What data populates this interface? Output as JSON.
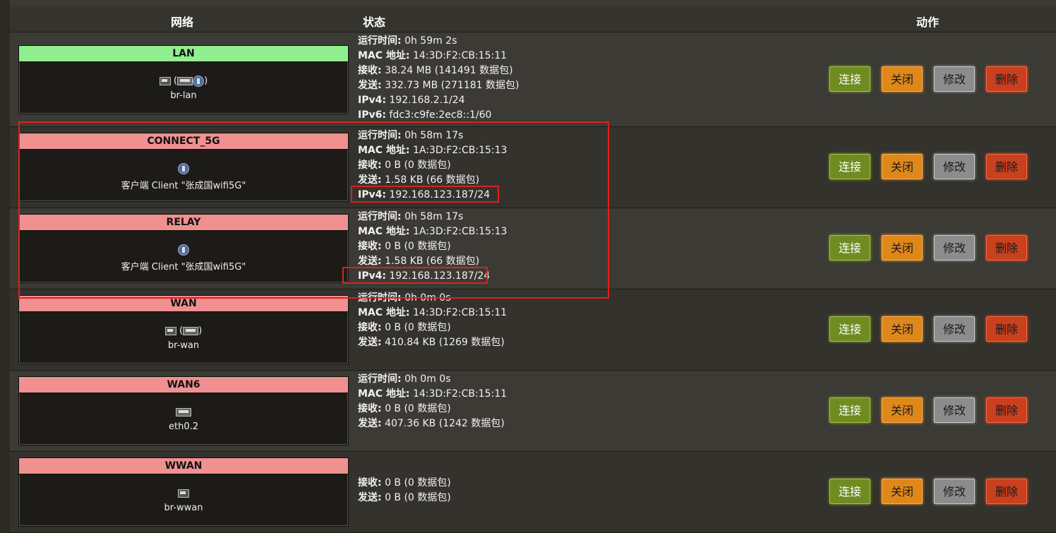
{
  "header": {
    "network": "网络",
    "status": "状态",
    "actions": "动作"
  },
  "buttons": {
    "connect": "连接",
    "stop": "关闭",
    "edit": "修改",
    "delete": "删除"
  },
  "colors": {
    "up": "#90ee90",
    "down": "#f09090",
    "highlight": "#e02020"
  },
  "interfaces": [
    {
      "name": "LAN",
      "state": "up",
      "icons": [
        "ethernet-icon",
        "switch-icon",
        "wifi-icon"
      ],
      "icon_text_open": "(",
      "icon_text_close": ")",
      "device": "br-lan",
      "status": [
        {
          "k": "运行时间:",
          "v": "0h 59m 2s"
        },
        {
          "k": "MAC 地址:",
          "v": "14:3D:F2:CB:15:11"
        },
        {
          "k": "接收:",
          "v": "38.24 MB (141491 数据包)"
        },
        {
          "k": "发送:",
          "v": "332.73 MB (271181 数据包)"
        },
        {
          "k": "IPv4:",
          "v": "192.168.2.1/24"
        },
        {
          "k": "IPv6:",
          "v": "fdc3:c9fe:2ec8::1/60"
        }
      ]
    },
    {
      "name": "CONNECT_5G",
      "state": "down",
      "icons": [
        "wifi-icon"
      ],
      "device": "客户端 Client \"张成国wifi5G\"",
      "status": [
        {
          "k": "运行时间:",
          "v": "0h 58m 17s"
        },
        {
          "k": "MAC 地址:",
          "v": "1A:3D:F2:CB:15:13"
        },
        {
          "k": "接收:",
          "v": "0 B (0 数据包)"
        },
        {
          "k": "发送:",
          "v": "1.58 KB (66 数据包)"
        },
        {
          "k": "IPv4:",
          "v": "192.168.123.187/24"
        }
      ]
    },
    {
      "name": "RELAY",
      "state": "down",
      "icons": [
        "wifi-icon"
      ],
      "device": "客户端 Client \"张成国wifi5G\"",
      "status": [
        {
          "k": "运行时间:",
          "v": "0h 58m 17s"
        },
        {
          "k": "MAC 地址:",
          "v": "1A:3D:F2:CB:15:13"
        },
        {
          "k": "接收:",
          "v": "0 B (0 数据包)"
        },
        {
          "k": "发送:",
          "v": "1.58 KB (66 数据包)"
        },
        {
          "k": "IPv4:",
          "v": "192.168.123.187/24"
        }
      ]
    },
    {
      "name": "WAN",
      "state": "down",
      "icons": [
        "ethernet-icon",
        "switch-icon"
      ],
      "icon_text_open": "(",
      "icon_text_close": ")",
      "device": "br-wan",
      "status": [
        {
          "k": "运行时间:",
          "v": "0h 0m 0s"
        },
        {
          "k": "MAC 地址:",
          "v": "14:3D:F2:CB:15:11"
        },
        {
          "k": "接收:",
          "v": "0 B (0 数据包)"
        },
        {
          "k": "发送:",
          "v": "410.84 KB (1269 数据包)"
        }
      ]
    },
    {
      "name": "WAN6",
      "state": "down",
      "icons": [
        "switch-icon"
      ],
      "device": "eth0.2",
      "status": [
        {
          "k": "运行时间:",
          "v": "0h 0m 0s"
        },
        {
          "k": "MAC 地址:",
          "v": "14:3D:F2:CB:15:11"
        },
        {
          "k": "接收:",
          "v": "0 B (0 数据包)"
        },
        {
          "k": "发送:",
          "v": "407.36 KB (1242 数据包)"
        }
      ]
    },
    {
      "name": "WWAN",
      "state": "down",
      "icons": [
        "ethernet-icon"
      ],
      "device": "br-wwan",
      "status": [
        {
          "k": "接收:",
          "v": "0 B (0 数据包)"
        },
        {
          "k": "发送:",
          "v": "0 B (0 数据包)"
        }
      ]
    }
  ]
}
